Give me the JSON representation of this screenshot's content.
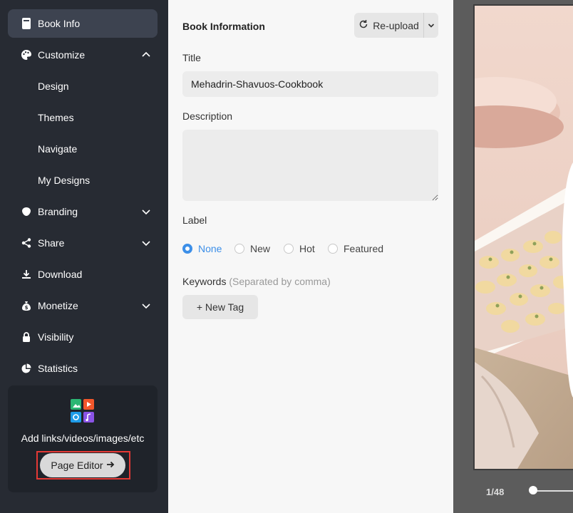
{
  "sidebar": {
    "items": [
      {
        "label": "Book Info"
      },
      {
        "label": "Customize"
      },
      {
        "label": "Branding"
      },
      {
        "label": "Share"
      },
      {
        "label": "Download"
      },
      {
        "label": "Monetize"
      },
      {
        "label": "Visibility"
      },
      {
        "label": "Statistics"
      }
    ],
    "customize_sub": [
      {
        "label": "Design"
      },
      {
        "label": "Themes"
      },
      {
        "label": "Navigate"
      },
      {
        "label": "My Designs"
      }
    ],
    "promo": {
      "text": "Add links/videos/images/etc",
      "button_label": "Page Editor"
    }
  },
  "main": {
    "section_title": "Book Information",
    "reupload_label": "Re-upload",
    "title_label": "Title",
    "title_value": "Mehadrin-Shavuos-Cookbook",
    "description_label": "Description",
    "description_value": "",
    "label_label": "Label",
    "label_options": [
      {
        "label": "None",
        "checked": true
      },
      {
        "label": "New",
        "checked": false
      },
      {
        "label": "Hot",
        "checked": false
      },
      {
        "label": "Featured",
        "checked": false
      }
    ],
    "keywords_label": "Keywords",
    "keywords_hint": "(Separated by comma)",
    "new_tag_label": "+ New Tag"
  },
  "preview": {
    "page_indicator": "1/48",
    "page_position": 0.0
  },
  "colors": {
    "sidebar_bg": "#272b33",
    "accent": "#3d8fe8",
    "highlight": "#e53935"
  }
}
